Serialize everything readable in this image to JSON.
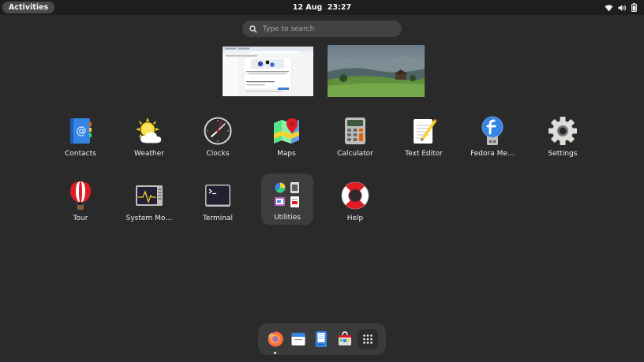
{
  "topbar": {
    "activities_label": "Activities",
    "datetime": "12 Aug  23:27",
    "tray_icons": [
      "network-wireless-icon",
      "volume-icon",
      "battery-icon"
    ]
  },
  "search": {
    "placeholder": "Type to search"
  },
  "windows": [
    {
      "name": "browser-document-window"
    },
    {
      "name": "landscape-photo-window"
    }
  ],
  "apps": [
    {
      "id": "contacts",
      "label": "Contacts",
      "icon": "contacts-icon"
    },
    {
      "id": "weather",
      "label": "Weather",
      "icon": "weather-icon"
    },
    {
      "id": "clocks",
      "label": "Clocks",
      "icon": "clocks-icon"
    },
    {
      "id": "maps",
      "label": "Maps",
      "icon": "maps-icon"
    },
    {
      "id": "calculator",
      "label": "Calculator",
      "icon": "calculator-icon"
    },
    {
      "id": "text-editor",
      "label": "Text Editor",
      "icon": "text-editor-icon"
    },
    {
      "id": "fedora-media-writer",
      "label": "Fedora Me…",
      "icon": "fedora-icon"
    },
    {
      "id": "settings",
      "label": "Settings",
      "icon": "settings-gear-icon"
    },
    {
      "id": "tour",
      "label": "Tour",
      "icon": "hot-air-balloon-icon"
    },
    {
      "id": "system-monitor",
      "label": "System Mo…",
      "icon": "system-monitor-icon"
    },
    {
      "id": "terminal",
      "label": "Terminal",
      "icon": "terminal-icon"
    },
    {
      "id": "utilities",
      "label": "Utilities",
      "icon": "utilities-folder-icon"
    },
    {
      "id": "help",
      "label": "Help",
      "icon": "help-lifebuoy-icon"
    }
  ],
  "dock": [
    {
      "name": "firefox",
      "icon": "firefox-icon",
      "running": true
    },
    {
      "name": "calendar",
      "icon": "calendar-icon",
      "running": false
    },
    {
      "name": "files",
      "icon": "files-icon",
      "running": false
    },
    {
      "name": "software",
      "icon": "software-icon",
      "running": false
    },
    {
      "name": "show-apps",
      "icon": "app-grid-icon",
      "running": false
    }
  ],
  "colors": {
    "background": "#2a2a2a",
    "topbar": "#1e1e1e",
    "accent": "#3584e4"
  }
}
